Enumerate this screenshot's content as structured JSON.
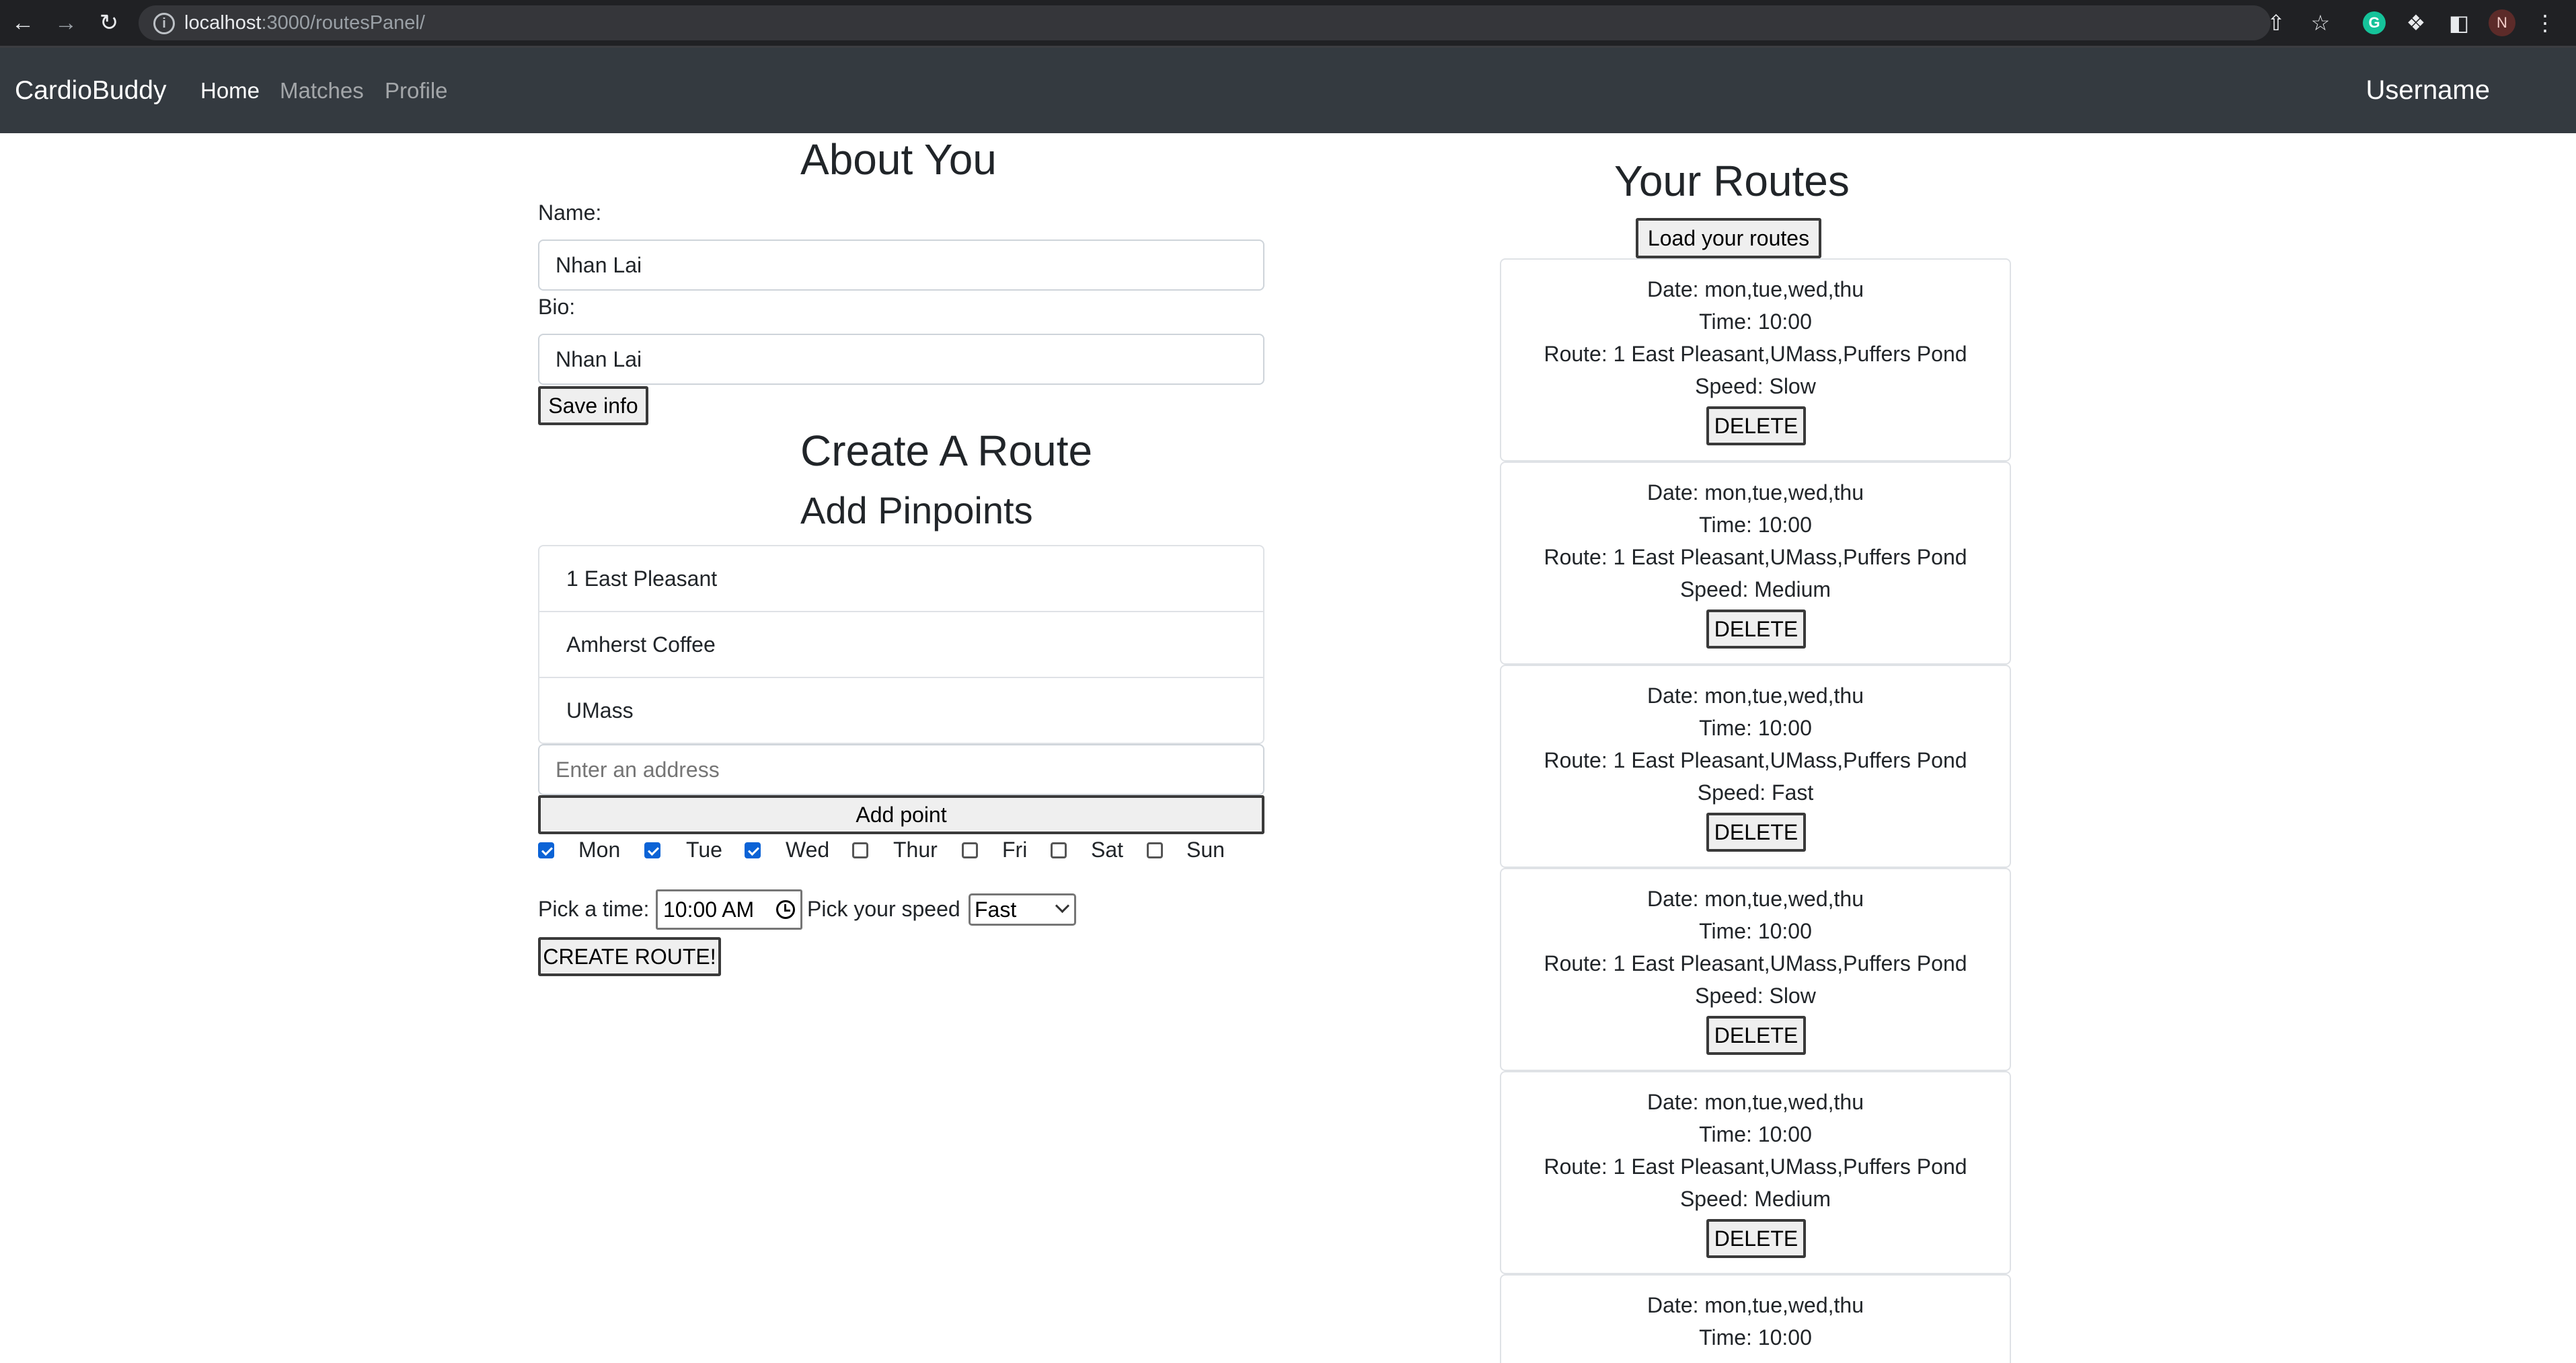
{
  "browser": {
    "url_host": "localhost",
    "url_rest": ":3000/routesPanel/",
    "profile_initial": "N",
    "grammarly_letter": "G"
  },
  "navbar": {
    "brand": "CardioBuddy",
    "links": [
      "Home",
      "Matches",
      "Profile"
    ],
    "active": "Home",
    "username": "Username"
  },
  "about": {
    "title": "About You",
    "name_label": "Name:",
    "name_value": "Nhan Lai",
    "bio_label": "Bio:",
    "bio_value": "Nhan Lai",
    "save_button": "Save info"
  },
  "create": {
    "title": "Create A Route",
    "subtitle": "Add Pinpoints",
    "pinpoints": [
      "1 East Pleasant",
      "Amherst Coffee",
      "UMass"
    ],
    "address_placeholder": "Enter an address",
    "add_point_button": "Add point",
    "days": [
      {
        "label": "Mon",
        "checked": true
      },
      {
        "label": "Tue",
        "checked": true
      },
      {
        "label": "Wed",
        "checked": true
      },
      {
        "label": "Thur",
        "checked": false
      },
      {
        "label": "Fri",
        "checked": false
      },
      {
        "label": "Sat",
        "checked": false
      },
      {
        "label": "Sun",
        "checked": false
      }
    ],
    "time_label": "Pick a time:",
    "time_value": "10:00 AM",
    "speed_label": "Pick your speed",
    "speed_value": "Fast",
    "create_button": "CREATE ROUTE!"
  },
  "routes": {
    "title": "Your Routes",
    "load_button": "Load your routes",
    "delete_label": "DELETE",
    "items": [
      {
        "date": "Date: mon,tue,wed,thu",
        "time": "Time: 10:00",
        "route": "Route: 1 East Pleasant,UMass,Puffers Pond",
        "speed": "Speed: Slow"
      },
      {
        "date": "Date: mon,tue,wed,thu",
        "time": "Time: 10:00",
        "route": "Route: 1 East Pleasant,UMass,Puffers Pond",
        "speed": "Speed: Medium"
      },
      {
        "date": "Date: mon,tue,wed,thu",
        "time": "Time: 10:00",
        "route": "Route: 1 East Pleasant,UMass,Puffers Pond",
        "speed": "Speed: Fast"
      },
      {
        "date": "Date: mon,tue,wed,thu",
        "time": "Time: 10:00",
        "route": "Route: 1 East Pleasant,UMass,Puffers Pond",
        "speed": "Speed: Slow"
      },
      {
        "date": "Date: mon,tue,wed,thu",
        "time": "Time: 10:00",
        "route": "Route: 1 East Pleasant,UMass,Puffers Pond",
        "speed": "Speed: Medium"
      },
      {
        "date": "Date: mon,tue,wed,thu",
        "time": "Time: 10:00",
        "route": "",
        "speed": ""
      }
    ]
  }
}
